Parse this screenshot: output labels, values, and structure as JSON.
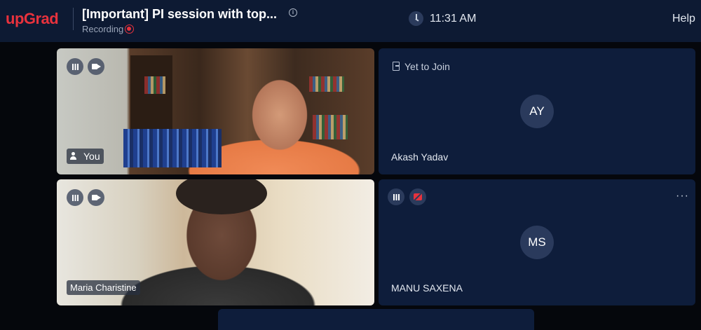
{
  "header": {
    "logo": "upGrad",
    "title": "[Important] PI session with top...",
    "recording_label": "Recording",
    "time": "11:31 AM",
    "help_label": "Help"
  },
  "participants": [
    {
      "name": "You",
      "video": "on",
      "audio": "on"
    },
    {
      "name": "Akash Yadav",
      "initials": "AY",
      "status": "Yet to Join"
    },
    {
      "name": "Maria Charistine",
      "video": "on",
      "audio": "on"
    },
    {
      "name": "MANU SAXENA",
      "initials": "MS",
      "video": "off",
      "audio": "on"
    }
  ],
  "colors": {
    "brand": "#e8323d",
    "header_bg": "#0d1a33",
    "tile_bg": "#0e1d3b"
  }
}
